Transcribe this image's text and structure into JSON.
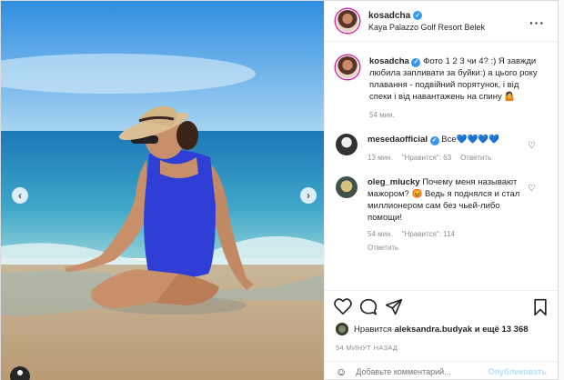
{
  "post": {
    "username": "kosadcha",
    "location": "Kaya Palazzo Golf Resort Belek"
  },
  "caption": {
    "username": "kosadcha",
    "text": "Фото 1 2 3 чи 4? :) Я завжди любила запливати за буйки:) а цього року плавання - подвійний порятунок, і від спеки і від навантажень на спину 🤷",
    "time": "54 мин."
  },
  "comments": [
    {
      "username": "mesedaofficial",
      "text": "Все",
      "hearts": "💙💙💙💙",
      "time": "13 мин.",
      "likes": "\"Нравится\": 63",
      "reply": "Ответить"
    },
    {
      "username": "oleg_mlucky",
      "text": "Почему меня называют мажором? 😡 Ведь я поднялся и стал миллионером сам без чьей-либо помощи!",
      "time": "54 мин.",
      "likes": "\"Нравится\": 114",
      "reply": "Ответить"
    }
  ],
  "likes": {
    "prefix": "Нравится",
    "user": "aleksandra.budyak",
    "suffix": "и ещё 13 368"
  },
  "timestamp": "54 МИНУТ НАЗАД",
  "add_comment": {
    "placeholder": "Добавьте комментарий...",
    "publish": "Опубликовать"
  },
  "icons": {
    "more": "more-icon",
    "heart": "heart-icon",
    "comment": "comment-icon",
    "share": "share-icon",
    "save": "bookmark-icon"
  },
  "colors": {
    "verified": "#3897f0",
    "swimsuit": "#2f3fd6",
    "sea": "#1e86c2",
    "sky": "#5aa9e6"
  }
}
